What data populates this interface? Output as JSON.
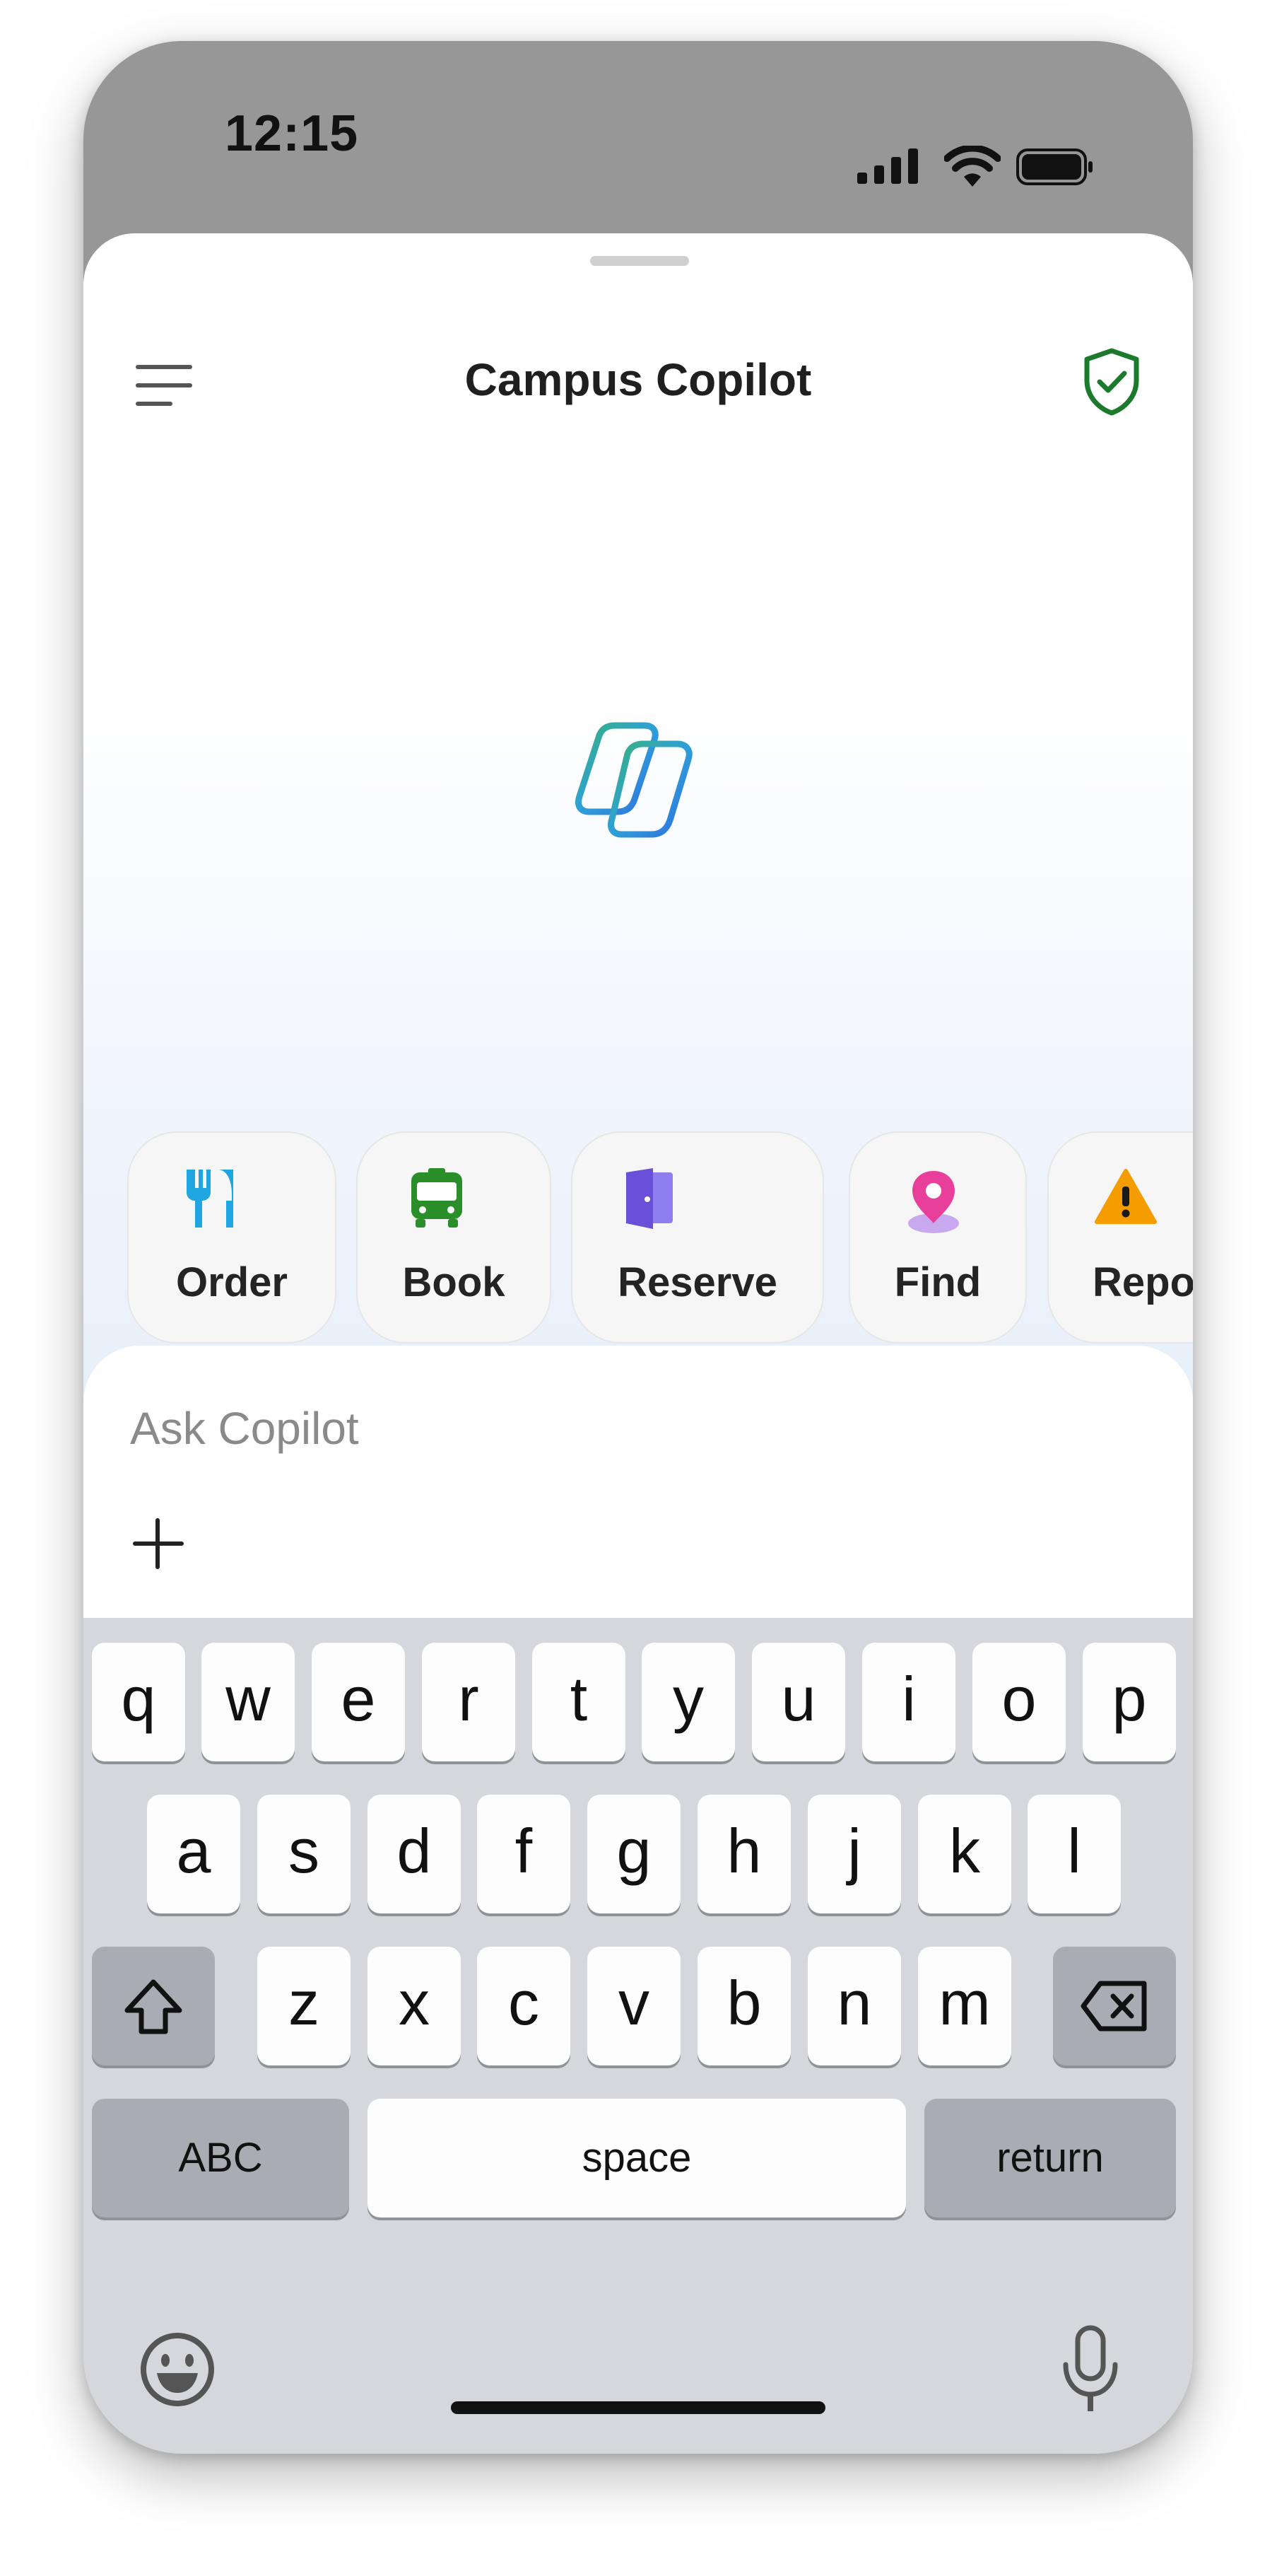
{
  "status_bar": {
    "time": "12:15"
  },
  "header": {
    "title": "Campus Copilot"
  },
  "quick_actions": [
    {
      "label": "Order",
      "icon": "fork-knife-icon"
    },
    {
      "label": "Book",
      "icon": "bus-icon"
    },
    {
      "label": "Reserve",
      "icon": "door-icon"
    },
    {
      "label": "Find",
      "icon": "map-pin-icon"
    },
    {
      "label": "Repo",
      "icon": "warning-icon"
    }
  ],
  "composer": {
    "placeholder": "Ask Copilot"
  },
  "keyboard": {
    "row1": [
      "q",
      "w",
      "e",
      "r",
      "t",
      "y",
      "u",
      "i",
      "o",
      "p"
    ],
    "row2": [
      "a",
      "s",
      "d",
      "f",
      "g",
      "h",
      "j",
      "k",
      "l"
    ],
    "row3": [
      "z",
      "x",
      "c",
      "v",
      "b",
      "n",
      "m"
    ],
    "abc": "ABC",
    "space": "space",
    "return": "return"
  },
  "colors": {
    "shield": "#1b7a2c",
    "order": "#1fa5e0",
    "book": "#2a8f2a",
    "reserve": "#6a4fd8",
    "find": "#e8409a",
    "report": "#f59c00"
  }
}
